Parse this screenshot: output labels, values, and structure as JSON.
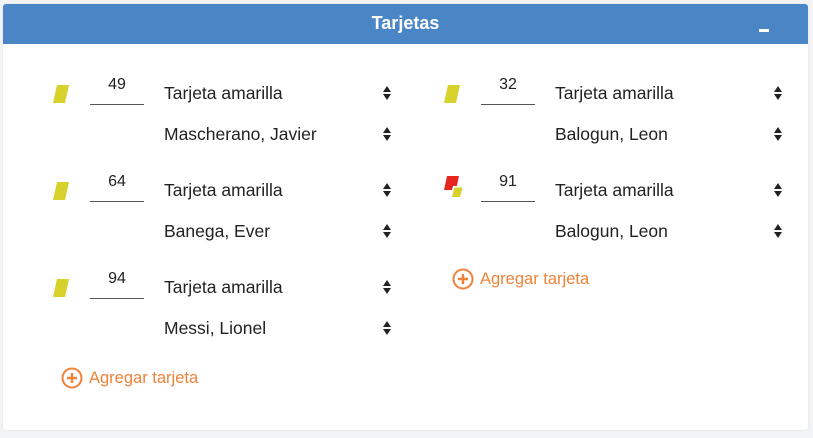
{
  "panel": {
    "title": "Tarjetas",
    "collapse_icon": "minus-icon"
  },
  "colors": {
    "header": "#4a86c5",
    "yellow_card": "#d6d12b",
    "red_card": "#e8241f",
    "add_link": "#ef8238"
  },
  "left": {
    "entries": [
      {
        "card": "yellow-card",
        "minute": "49",
        "type": "Tarjeta amarilla",
        "player": "Mascherano, Javier"
      },
      {
        "card": "yellow-card",
        "minute": "64",
        "type": "Tarjeta amarilla",
        "player": "Banega, Ever"
      },
      {
        "card": "yellow-card",
        "minute": "94",
        "type": "Tarjeta amarilla",
        "player": "Messi, Lionel"
      }
    ],
    "add_label": "Agregar tarjeta"
  },
  "right": {
    "entries": [
      {
        "card": "yellow-card",
        "minute": "32",
        "type": "Tarjeta amarilla",
        "player": "Balogun, Leon"
      },
      {
        "card": "second-yellow-red-card",
        "minute": "91",
        "type": "Tarjeta amarilla",
        "player": "Balogun, Leon"
      }
    ],
    "add_label": "Agregar tarjeta"
  }
}
